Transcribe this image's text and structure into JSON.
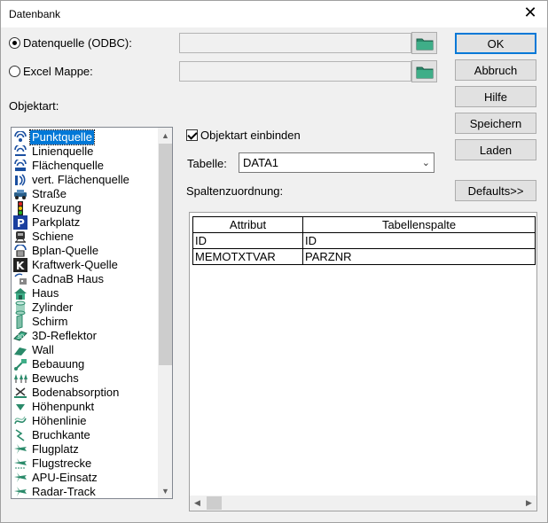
{
  "window": {
    "title": "Datenbank",
    "close_glyph": "✕"
  },
  "source": {
    "odbc_label": "Datenquelle (ODBC):",
    "odbc_selected": true,
    "excel_label": "Excel Mappe:",
    "excel_selected": false,
    "odbc_path": "",
    "excel_path": ""
  },
  "buttons": {
    "ok": "OK",
    "cancel": "Abbruch",
    "help": "Hilfe",
    "save": "Speichern",
    "load": "Laden",
    "defaults": "Defaults>>"
  },
  "objektart": {
    "label": "Objektart:",
    "items": [
      {
        "label": "Punktquelle",
        "icon": "point-source-icon",
        "selected": true
      },
      {
        "label": "Linienquelle",
        "icon": "line-source-icon"
      },
      {
        "label": "Flächenquelle",
        "icon": "area-source-icon"
      },
      {
        "label": "vert. Flächenquelle",
        "icon": "vertical-area-source-icon"
      },
      {
        "label": "Straße",
        "icon": "car-icon"
      },
      {
        "label": "Kreuzung",
        "icon": "traffic-light-icon"
      },
      {
        "label": "Parkplatz",
        "icon": "parking-icon"
      },
      {
        "label": "Schiene",
        "icon": "train-icon"
      },
      {
        "label": "Bplan-Quelle",
        "icon": "bplan-source-icon"
      },
      {
        "label": "Kraftwerk-Quelle",
        "icon": "power-plant-icon"
      },
      {
        "label": "CadnaB Haus",
        "icon": "cadnab-house-icon"
      },
      {
        "label": "Haus",
        "icon": "house-icon"
      },
      {
        "label": "Zylinder",
        "icon": "cylinder-icon"
      },
      {
        "label": "Schirm",
        "icon": "screen-icon"
      },
      {
        "label": "3D-Reflektor",
        "icon": "reflector-3d-icon"
      },
      {
        "label": "Wall",
        "icon": "wall-icon"
      },
      {
        "label": "Bebauung",
        "icon": "building-area-icon"
      },
      {
        "label": "Bewuchs",
        "icon": "vegetation-icon"
      },
      {
        "label": "Bodenabsorption",
        "icon": "ground-absorption-icon"
      },
      {
        "label": "Höhenpunkt",
        "icon": "height-point-icon"
      },
      {
        "label": "Höhenlinie",
        "icon": "contour-line-icon"
      },
      {
        "label": "Bruchkante",
        "icon": "break-line-icon"
      },
      {
        "label": "Flugplatz",
        "icon": "airfield-icon"
      },
      {
        "label": "Flugstrecke",
        "icon": "flight-route-icon"
      },
      {
        "label": "APU-Einsatz",
        "icon": "apu-icon"
      },
      {
        "label": "Radar-Track",
        "icon": "radar-track-icon"
      }
    ]
  },
  "include": {
    "label": "Objektart einbinden",
    "checked": true
  },
  "table": {
    "label": "Tabelle:",
    "value": "DATA1"
  },
  "mapping": {
    "label": "Spaltenzuordnung:",
    "headers": [
      "Attribut",
      "Tabellenspalte"
    ],
    "rows": [
      [
        "ID",
        "ID"
      ],
      [
        "MEMOTXTVAR",
        "PARZNR"
      ]
    ]
  },
  "colors": {
    "accent": "#0078d7",
    "folder": "#2a8a6a"
  }
}
